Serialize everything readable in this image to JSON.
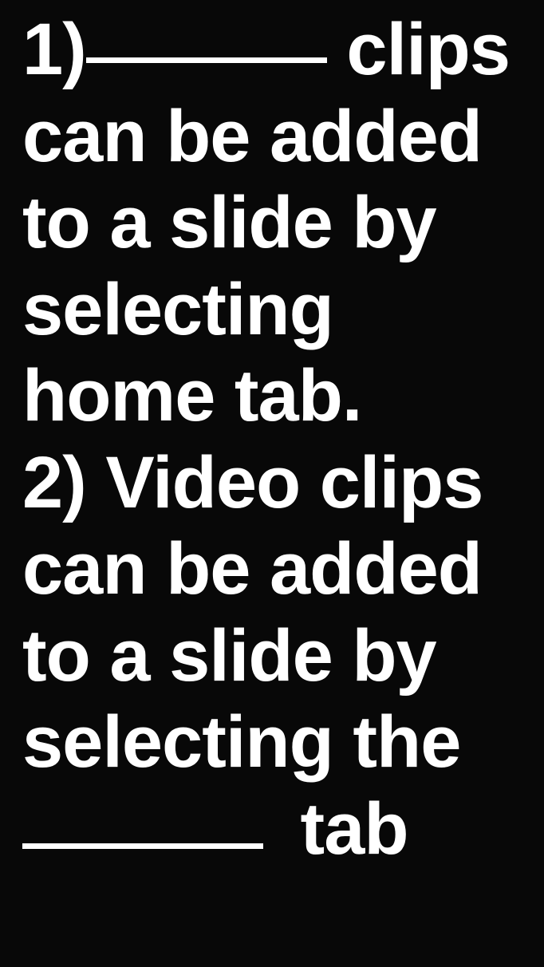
{
  "questions": {
    "q1": {
      "number": "1)",
      "line1_after": " clips",
      "line2": "can be added",
      "line3": "to a slide by",
      "line4": "selecting",
      "line5": "home tab."
    },
    "q2": {
      "number": "2)",
      "line1": " Video clips",
      "line2": "can be added",
      "line3": "to a slide by",
      "line4": "selecting the",
      "line5_after": " tab"
    }
  }
}
